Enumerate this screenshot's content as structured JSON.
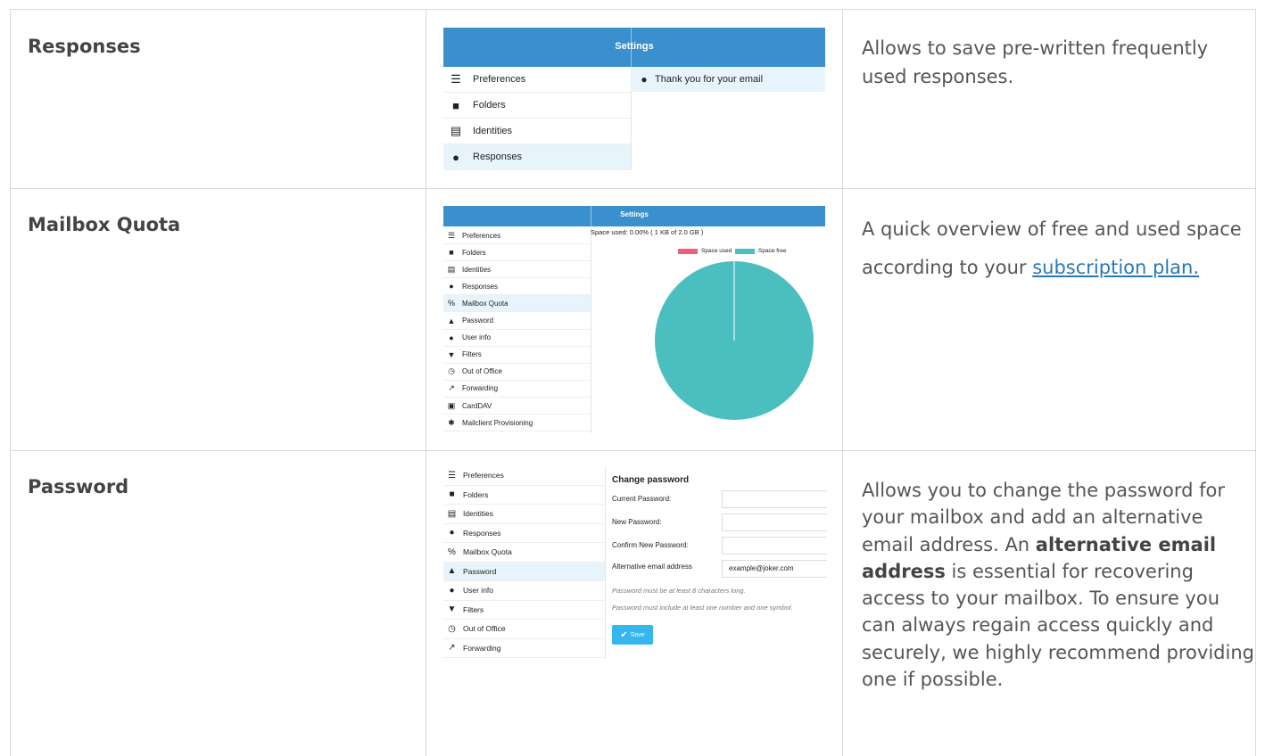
{
  "rows": [
    {
      "label": "Responses",
      "description": "Allows to save pre-written frequently used responses."
    },
    {
      "label": "Mailbox Quota",
      "description_pre": "A quick overview of free and used space according to your ",
      "description_link": "subscription plan."
    },
    {
      "label": "Password",
      "description_pre": "Allows you to change the password for your mailbox and add an alternative email address. An ",
      "description_bold": "alternative email address",
      "description_post": " is essential for recovering access to your mailbox. To ensure you can always regain access quickly and securely, we highly recommend providing one if possible."
    }
  ],
  "shot_responses": {
    "header_title": "Settings",
    "menu": [
      {
        "label": "Preferences",
        "icon": "sliders-icon"
      },
      {
        "label": "Folders",
        "icon": "folder-icon"
      },
      {
        "label": "Identities",
        "icon": "id-card-icon"
      },
      {
        "label": "Responses",
        "icon": "comment-icon",
        "active": true
      }
    ],
    "response_item": "Thank you for your email"
  },
  "shot_quota": {
    "header_title": "Settings",
    "menu": [
      {
        "label": "Preferences",
        "icon": "sliders-icon"
      },
      {
        "label": "Folders",
        "icon": "folder-icon"
      },
      {
        "label": "Identities",
        "icon": "id-card-icon"
      },
      {
        "label": "Responses",
        "icon": "comment-icon"
      },
      {
        "label": "Mailbox Quota",
        "icon": "percent-icon",
        "active": true
      },
      {
        "label": "Password",
        "icon": "lock-icon"
      },
      {
        "label": "User info",
        "icon": "info-icon"
      },
      {
        "label": "Filters",
        "icon": "filter-icon"
      },
      {
        "label": "Out of Office",
        "icon": "clock-icon"
      },
      {
        "label": "Forwarding",
        "icon": "share-icon"
      },
      {
        "label": "CardDAV",
        "icon": "contact-card-icon"
      },
      {
        "label": "Mailclient Provisioning",
        "icon": "gear-icon"
      }
    ],
    "space_used_text": "Space used: 0.00% ( 1 KB of 2.0 GB )",
    "legend_used": "Space used",
    "legend_free": "Space free",
    "color_used": "#f0607e",
    "color_free": "#4bbfbf",
    "used_fraction": 0.0
  },
  "shot_password": {
    "menu": [
      {
        "label": "Preferences",
        "icon": "sliders-icon"
      },
      {
        "label": "Folders",
        "icon": "folder-icon"
      },
      {
        "label": "Identities",
        "icon": "id-card-icon"
      },
      {
        "label": "Responses",
        "icon": "comment-icon"
      },
      {
        "label": "Mailbox Quota",
        "icon": "percent-icon"
      },
      {
        "label": "Password",
        "icon": "lock-icon",
        "active": true
      },
      {
        "label": "User info",
        "icon": "info-icon"
      },
      {
        "label": "Filters",
        "icon": "filter-icon"
      },
      {
        "label": "Out of Office",
        "icon": "clock-icon"
      },
      {
        "label": "Forwarding",
        "icon": "share-icon"
      }
    ],
    "title": "Change password",
    "current_label": "Current Password:",
    "new_label": "New Password:",
    "confirm_label": "Confirm New Password:",
    "alt_label": "Alternative email address",
    "alt_value": "example@joker.com",
    "note1": "Password must be at least 8 characters long.",
    "note2": "Password must include at least one number and one symbol.",
    "save_label": "Save"
  }
}
